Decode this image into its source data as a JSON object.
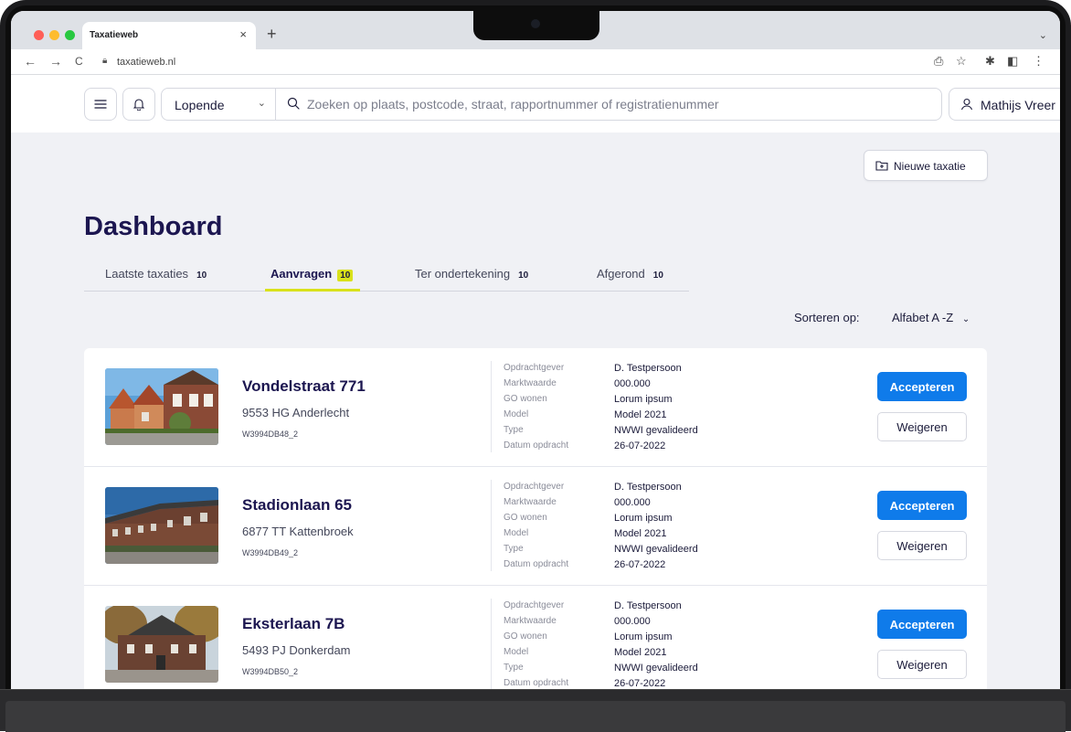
{
  "browser": {
    "tab_title": "Taxatieweb",
    "tab_close": "×",
    "new_tab": "+",
    "tab_menu": "⌄",
    "url": "taxatieweb.nl",
    "back": "←",
    "forward": "→",
    "reload": "C",
    "icons": {
      "share": "⎙",
      "star": "☆",
      "extensions": "✱",
      "sidepanel": "◧",
      "menu": "⋮"
    }
  },
  "header": {
    "status_select": "Lopende",
    "search_placeholder": "Zoeken op plaats, postcode, straat, rapportnummer of registratienummer",
    "user_name": "Mathijs Vreer"
  },
  "actions": {
    "new_valuation": "Nieuwe taxatie"
  },
  "page_title": "Dashboard",
  "tabs": [
    {
      "label": "Laatste taxaties",
      "count": "10"
    },
    {
      "label": "Aanvragen",
      "count": "10"
    },
    {
      "label": "Ter ondertekening",
      "count": "10"
    },
    {
      "label": "Afgerond",
      "count": "10"
    }
  ],
  "active_tab": "Aanvragen",
  "sort": {
    "label": "Sorteren op:",
    "value": "Alfabet A -Z"
  },
  "meta_labels": [
    "Opdrachtgever",
    "Marktwaarde",
    "GO wonen",
    "Model",
    "Type",
    "Datum opdracht"
  ],
  "requests": [
    {
      "address": "Vondelstraat 771",
      "city": "9553 HG Anderlecht",
      "code": "W3994DB48_2",
      "values": [
        "D. Testpersoon",
        "000.000",
        "Lorum ipsum",
        "Model 2021",
        "NWWI gevalideerd",
        "26-07-2022"
      ],
      "accept": "Accepteren",
      "reject": "Weigeren"
    },
    {
      "address": "Stadionlaan 65",
      "city": "6877 TT Kattenbroek",
      "code": "W3994DB49_2",
      "values": [
        "D. Testpersoon",
        "000.000",
        "Lorum ipsum",
        "Model 2021",
        "NWWI gevalideerd",
        "26-07-2022"
      ],
      "accept": "Accepteren",
      "reject": "Weigeren"
    },
    {
      "address": "Eksterlaan 7B",
      "city": "5493 PJ Donkerdam",
      "code": "W3994DB50_2",
      "values": [
        "D. Testpersoon",
        "000.000",
        "Lorum ipsum",
        "Model 2021",
        "NWWI gevalideerd",
        "26-07-2022"
      ],
      "accept": "Accepteren",
      "reject": "Weigeren"
    }
  ],
  "colors": {
    "accent_blue": "#0f7bea",
    "badge_yellow": "#d9e11b",
    "title_navy": "#1c1650",
    "page_bg": "#f0f1f5"
  }
}
